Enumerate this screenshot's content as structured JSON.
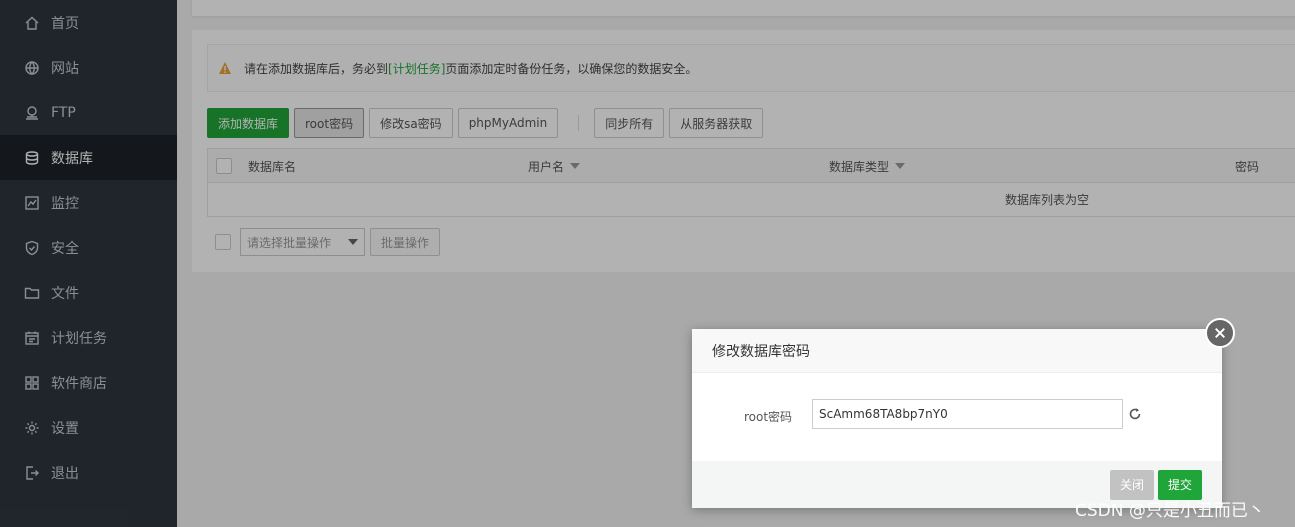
{
  "sidebar": {
    "items": [
      {
        "label": "首页",
        "icon": "home-icon"
      },
      {
        "label": "网站",
        "icon": "globe-icon"
      },
      {
        "label": "FTP",
        "icon": "ftp-icon"
      },
      {
        "label": "数据库",
        "icon": "database-icon",
        "active": true
      },
      {
        "label": "监控",
        "icon": "monitor-icon"
      },
      {
        "label": "安全",
        "icon": "shield-icon"
      },
      {
        "label": "文件",
        "icon": "folder-icon"
      },
      {
        "label": "计划任务",
        "icon": "calendar-icon"
      },
      {
        "label": "软件商店",
        "icon": "apps-icon"
      },
      {
        "label": "设置",
        "icon": "gear-icon"
      },
      {
        "label": "退出",
        "icon": "logout-icon"
      }
    ]
  },
  "alert": {
    "prefix": "请在添加数据库后，务必到",
    "link": "[计划任务]",
    "suffix": "页面添加定时备份任务，以确保您的数据安全。"
  },
  "toolbar": {
    "add_db": "添加数据库",
    "root_pwd": "root密码",
    "sa_pwd": "修改sa密码",
    "phpmyadmin": "phpMyAdmin",
    "sync_all": "同步所有",
    "fetch_server": "从服务器获取"
  },
  "table": {
    "headers": {
      "name": "数据库名",
      "user": "用户名",
      "type": "数据库类型",
      "password": "密码"
    },
    "empty": "数据库列表为空"
  },
  "batch": {
    "placeholder": "请选择批量操作",
    "button": "批量操作"
  },
  "dialog": {
    "title": "修改数据库密码",
    "label": "root密码",
    "value": "ScAmm68TA8bp7nY0",
    "close": "关闭",
    "submit": "提交"
  },
  "watermark": "CSDN @只是小丑而已丶",
  "colors": {
    "accent": "#20a53a",
    "sidebar_bg": "#2f353f",
    "warning": "#e6a23c"
  }
}
